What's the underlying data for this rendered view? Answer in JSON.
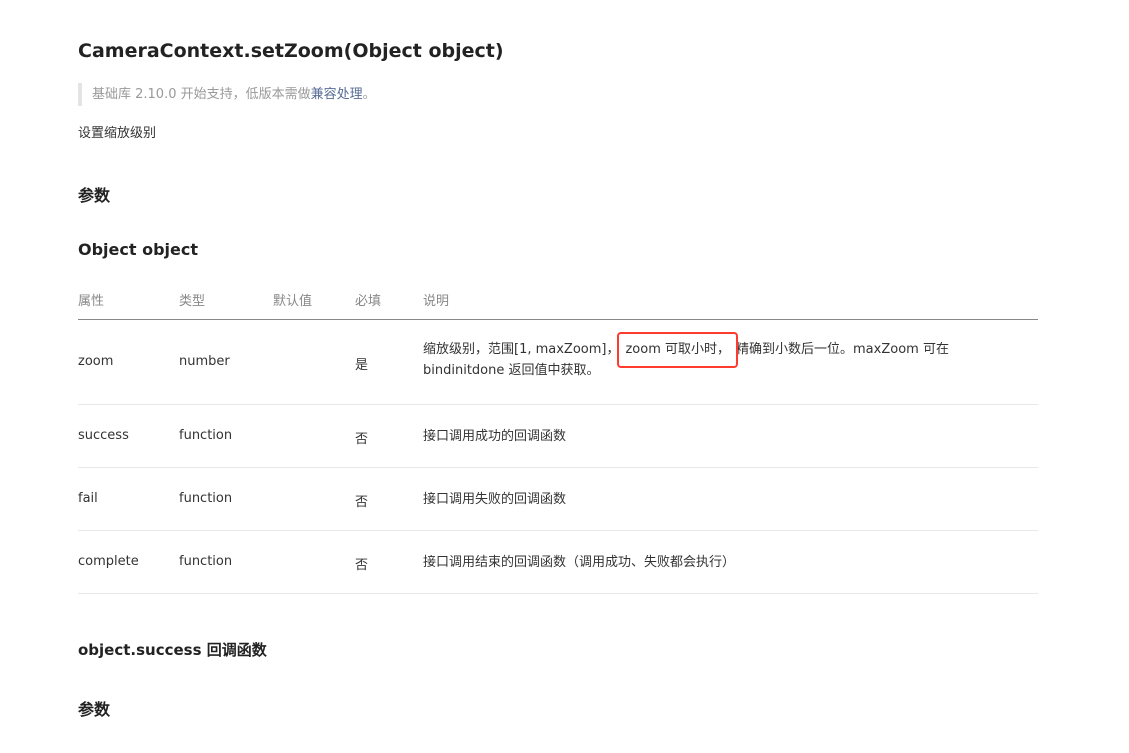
{
  "title": "CameraContext.setZoom(Object object)",
  "note": {
    "text": "基础库 2.10.0 开始支持，低版本需做",
    "link": "兼容处理",
    "suffix": "。"
  },
  "description": "设置缩放级别",
  "params_heading": "参数",
  "object_heading": "Object object",
  "table": {
    "headers": [
      "属性",
      "类型",
      "默认值",
      "必填",
      "说明"
    ],
    "rows": [
      {
        "name": "zoom",
        "type": "number",
        "default": "",
        "required": "是",
        "desc_line1_a": "缩放级别，范围[1, maxZoom]，",
        "desc_line1_hl": "zoom 可取小时，",
        "desc_line1_b": "精确到小数后一位。maxZoom 可在",
        "desc_line2": "bindinitdone 返回值中获取。"
      },
      {
        "name": "success",
        "type": "function",
        "default": "",
        "required": "否",
        "desc": "接口调用成功的回调函数"
      },
      {
        "name": "fail",
        "type": "function",
        "default": "",
        "required": "否",
        "desc": "接口调用失败的回调函数"
      },
      {
        "name": "complete",
        "type": "function",
        "default": "",
        "required": "否",
        "desc": "接口调用结束的回调函数（调用成功、失败都会执行）"
      }
    ]
  },
  "success_heading": "object.success 回调函数",
  "params_heading_2": "参数",
  "colors": {
    "link": "#576b95",
    "highlight_border": "#ff3b30",
    "note_bar": "#e4e4e4"
  }
}
